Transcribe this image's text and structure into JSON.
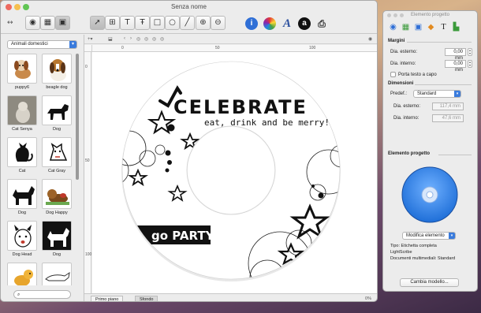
{
  "window": {
    "title": "Senza nome"
  },
  "toolbar": {
    "icons": [
      "arrows-icon",
      "camera-icon",
      "grid-icon",
      "photo-icon",
      "pointer-icon",
      "textbox-icon",
      "text-arc-icon",
      "text-path-icon",
      "rectangle-icon",
      "ellipse-icon",
      "line-icon",
      "zoom-in-icon",
      "zoom-out-icon",
      "info-icon",
      "color-wheel-icon",
      "font-icon",
      "amazon-icon",
      "print-icon"
    ],
    "font_glyph": "A",
    "amazon_glyph": "a",
    "info_glyph": "i"
  },
  "sidebar": {
    "category": "Animali domestici",
    "clips": [
      "puppy6",
      "beagle dog",
      "Cat Senya",
      "Dog",
      "Cat",
      "Cat Gray",
      "Dog",
      "Dog Happy",
      "Dog Head",
      "Dog",
      "",
      ""
    ],
    "search_placeholder": ""
  },
  "rulers": {
    "h": [
      "0",
      "50",
      "100"
    ],
    "v": [
      "0",
      "50",
      "100"
    ]
  },
  "label": {
    "celebrate_text": "CELEBRATE",
    "tagline": "eat, drink and be merry!",
    "party_text": "go PARTY!"
  },
  "status": {
    "tab_front": "Primo piano",
    "tab_back": "Sfondo",
    "zoom": "0%"
  },
  "inspector": {
    "title": "Elemento progetto",
    "margins": {
      "heading": "Margini",
      "outer_label": "Dia. esterno:",
      "outer_value": "0,00 mm",
      "inner_label": "Dia. interno:",
      "inner_value": "0,00 mm",
      "wrap_label": "Porta testo a capo"
    },
    "dimensions": {
      "heading": "Dimensioni",
      "preset_label": "Predef.:",
      "preset_value": "Standard",
      "outer_label": "Dia. esterno:",
      "outer_value": "117,4 mm",
      "inner_label": "Dia. interno:",
      "inner_value": "47,6 mm"
    },
    "element": {
      "heading": "Elemento progetto",
      "modify_label": "Modifica elemento",
      "type_line": "Tipo: Etichetta completa",
      "lightscribe": "LightScribe",
      "docs_line": "Documenti multimediali: Standard",
      "change_model": "Cambia modello..."
    }
  },
  "colors": {
    "accent": "#3a7bdc",
    "disc_blue": "#1f6fd8",
    "text_dark": "#111111"
  }
}
